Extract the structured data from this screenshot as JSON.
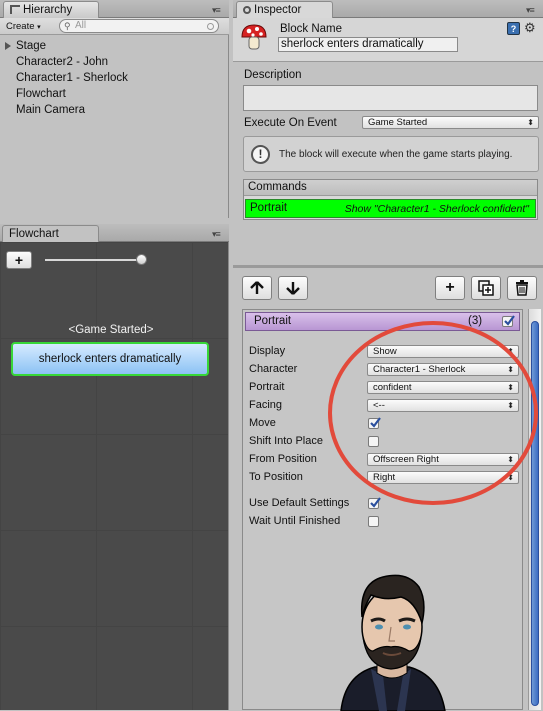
{
  "hierarchy": {
    "tab_label": "Hierarchy",
    "create_label": "Create",
    "search_placeholder": "All",
    "items": [
      "Stage",
      "Character2 - John",
      "Character1 - Sherlock",
      "Flowchart",
      "Main Camera"
    ]
  },
  "flowchart": {
    "tab_label": "Flowchart",
    "add_label": "+",
    "event_label": "<Game Started>",
    "block_label": "sherlock enters dramatically"
  },
  "inspector": {
    "tab_label": "Inspector",
    "block_name_label": "Block Name",
    "block_name_value": "sherlock enters dramatically",
    "description_label": "Description",
    "description_value": "",
    "execute_label": "Execute On Event",
    "execute_value": "Game Started",
    "info_text": "The block will execute when the game starts playing.",
    "commands_header": "Commands",
    "command": {
      "name": "Portrait",
      "summary": "Show \"Character1 - Sherlock confident\""
    }
  },
  "command_panel": {
    "title": "Portrait",
    "count": "(3)",
    "enabled": true,
    "fields": [
      {
        "label": "Display",
        "type": "dropdown",
        "value": "Show"
      },
      {
        "label": "Character",
        "type": "dropdown",
        "value": "Character1 - Sherlock"
      },
      {
        "label": "Portrait",
        "type": "dropdown",
        "value": "confident"
      },
      {
        "label": "Facing",
        "type": "dropdown",
        "value": "<--"
      },
      {
        "label": "Move",
        "type": "checkbox",
        "checked": true
      },
      {
        "label": "Shift Into Place",
        "type": "checkbox",
        "checked": false
      },
      {
        "label": "From Position",
        "type": "dropdown",
        "value": "Offscreen Right"
      },
      {
        "label": "To Position",
        "type": "dropdown",
        "value": "Right"
      },
      {
        "label": "Use Default Settings",
        "type": "checkbox",
        "checked": true
      },
      {
        "label": "Wait Until Finished",
        "type": "checkbox",
        "checked": false
      }
    ]
  },
  "colors": {
    "command_highlight": "#00ff00",
    "block_fill": "#9cc9f5",
    "block_border": "#37d737",
    "annotation_circle": "#e24a3b",
    "command_header": "#c8aade"
  },
  "icons": [
    "hierarchy-icon",
    "inspector-icon",
    "mushroom-icon",
    "help-icon",
    "gear-icon",
    "warning-icon",
    "up-arrow-icon",
    "down-arrow-icon",
    "add-icon",
    "duplicate-icon",
    "trash-icon",
    "sherlock-portrait"
  ]
}
